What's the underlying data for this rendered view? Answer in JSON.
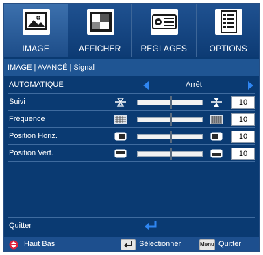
{
  "tabs": [
    {
      "label": "IMAGE",
      "icon": "image-landscape-icon",
      "active": true
    },
    {
      "label": "AFFICHER",
      "icon": "display-screen-icon",
      "active": false
    },
    {
      "label": "REGLAGES",
      "icon": "projector-settings-icon",
      "active": false
    },
    {
      "label": "OPTIONS",
      "icon": "options-checklist-icon",
      "active": false
    }
  ],
  "breadcrumb": "IMAGE | AVANCÉ | Signal",
  "automatique": {
    "label": "AUTOMATIQUE",
    "value": "Arrêt"
  },
  "settings": [
    {
      "label": "Suivi",
      "value": "10",
      "level": 0.52
    },
    {
      "label": "Fréquence",
      "value": "10",
      "level": 0.52
    },
    {
      "label": "Position Horiz.",
      "value": "10",
      "level": 0.52
    },
    {
      "label": "Position Vert.",
      "value": "10",
      "level": 0.52
    }
  ],
  "quit": {
    "label": "Quitter"
  },
  "footer": {
    "nav_label": "Haut Bas",
    "select_label": "Sélectionner",
    "menu_key": "Menu",
    "quit_label": "Quitter"
  },
  "colors": {
    "accent": "#2f86f2",
    "background": "#0a3a72",
    "highlight": "#1f5593",
    "nav_dot": "#e0223c"
  }
}
